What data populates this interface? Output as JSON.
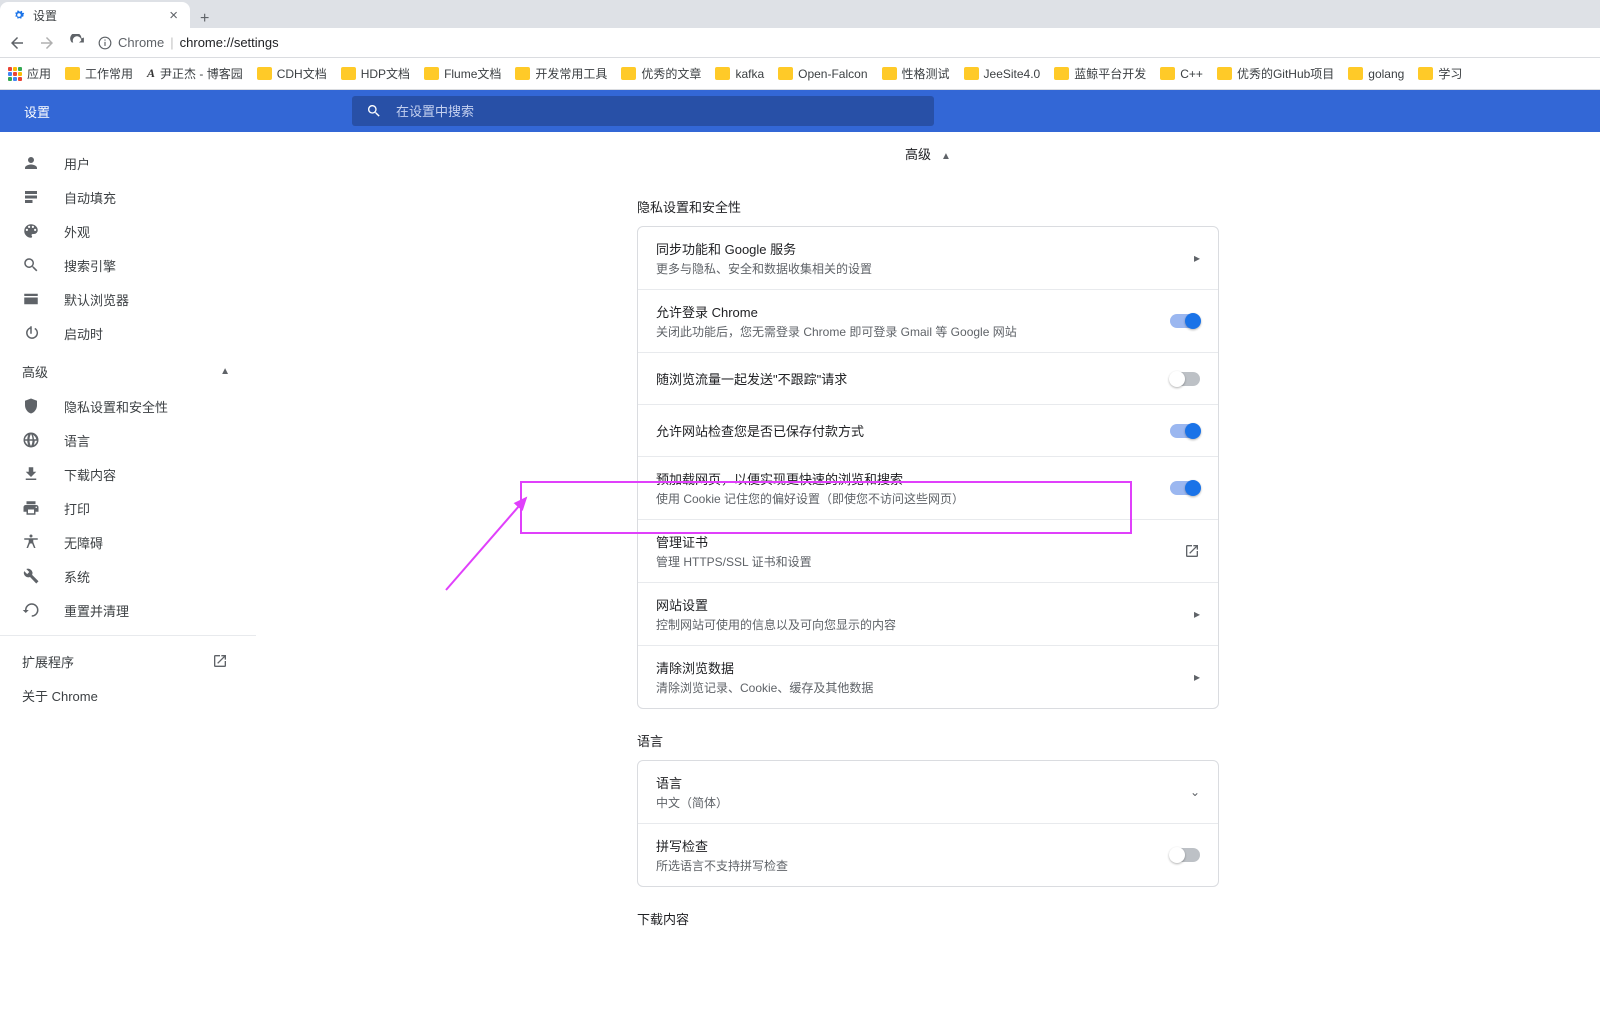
{
  "tab": {
    "title": "设置"
  },
  "address": {
    "host": "Chrome",
    "path": "chrome://settings"
  },
  "bookmarks": {
    "apps": "应用",
    "items": [
      "工作常用",
      "尹正杰 - 博客园",
      "CDH文档",
      "HDP文档",
      "Flume文档",
      "开发常用工具",
      "优秀的文章",
      "kafka",
      "Open-Falcon",
      "性格测试",
      "JeeSite4.0",
      "蓝鲸平台开发",
      "C++",
      "优秀的GitHub项目",
      "golang",
      "学习"
    ],
    "special_index": 1
  },
  "header": {
    "title": "设置",
    "search_placeholder": "在设置中搜索"
  },
  "sidebar": {
    "basic": [
      {
        "label": "用户",
        "icon": "person"
      },
      {
        "label": "自动填充",
        "icon": "autofill"
      },
      {
        "label": "外观",
        "icon": "palette"
      },
      {
        "label": "搜索引擎",
        "icon": "search"
      },
      {
        "label": "默认浏览器",
        "icon": "browser"
      },
      {
        "label": "启动时",
        "icon": "power"
      }
    ],
    "advanced_label": "高级",
    "advanced": [
      {
        "label": "隐私设置和安全性",
        "icon": "shield"
      },
      {
        "label": "语言",
        "icon": "globe"
      },
      {
        "label": "下载内容",
        "icon": "download"
      },
      {
        "label": "打印",
        "icon": "print"
      },
      {
        "label": "无障碍",
        "icon": "accessibility"
      },
      {
        "label": "系统",
        "icon": "wrench"
      },
      {
        "label": "重置并清理",
        "icon": "restore"
      }
    ],
    "extensions": "扩展程序",
    "about": "关于 Chrome"
  },
  "main": {
    "advanced_header": "高级",
    "privacy_title": "隐私设置和安全性",
    "privacy_rows": [
      {
        "title": "同步功能和 Google 服务",
        "sub": "更多与隐私、安全和数据收集相关的设置",
        "action": "arrow"
      },
      {
        "title": "允许登录 Chrome",
        "sub": "关闭此功能后，您无需登录 Chrome 即可登录 Gmail 等 Google 网站",
        "action": "toggle",
        "on": true
      },
      {
        "title": "随浏览流量一起发送\"不跟踪\"请求",
        "action": "toggle",
        "on": false
      },
      {
        "title": "允许网站检查您是否已保存付款方式",
        "action": "toggle",
        "on": true
      },
      {
        "title": "预加载网页，以便实现更快速的浏览和搜索",
        "sub": "使用 Cookie 记住您的偏好设置（即使您不访问这些网页）",
        "action": "toggle",
        "on": true
      },
      {
        "title": "管理证书",
        "sub": "管理 HTTPS/SSL 证书和设置",
        "action": "launch"
      },
      {
        "title": "网站设置",
        "sub": "控制网站可使用的信息以及可向您显示的内容",
        "action": "arrow"
      },
      {
        "title": "清除浏览数据",
        "sub": "清除浏览记录、Cookie、缓存及其他数据",
        "action": "arrow"
      }
    ],
    "lang_title": "语言",
    "lang_rows": [
      {
        "title": "语言",
        "sub": "中文（简体）",
        "action": "expand"
      },
      {
        "title": "拼写检查",
        "sub": "所选语言不支持拼写检查",
        "action": "toggle",
        "on": false
      }
    ],
    "download_title": "下载内容"
  }
}
